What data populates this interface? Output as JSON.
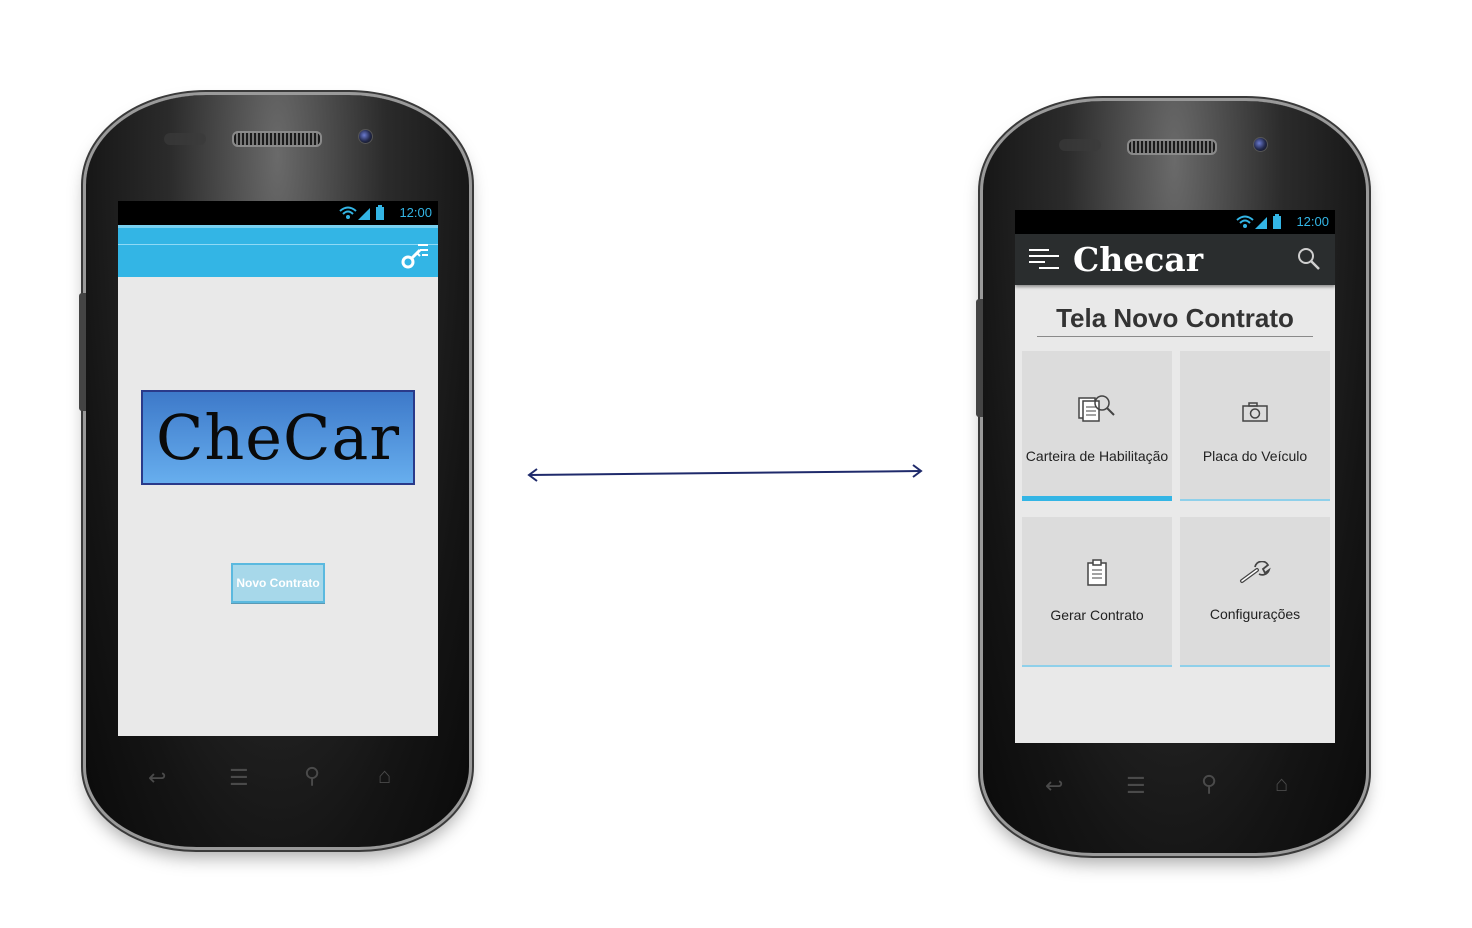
{
  "status_bar": {
    "time": "12:00"
  },
  "left_screen": {
    "logo_text": "CheCar",
    "primary_button": "Novo Contrato",
    "action_icon": "key-menu-icon"
  },
  "right_screen": {
    "app_title": "Checar",
    "nav_icon": "drawer-menu-icon",
    "search_icon": "search-icon",
    "heading": "Tela Novo Contrato",
    "tiles": [
      {
        "label": "Carteira de Habilitação",
        "icon": "document-search-icon",
        "selected": true
      },
      {
        "label": "Placa do Veículo",
        "icon": "camera-icon",
        "selected": false
      },
      {
        "label": "Gerar Contrato",
        "icon": "clipboard-icon",
        "selected": false
      },
      {
        "label": "Configurações",
        "icon": "wrench-icon",
        "selected": false
      }
    ]
  },
  "colors": {
    "accent": "#33b5e5",
    "action_bar_dark": "#2a2d2e",
    "logo_gradient_top": "#3d79c9",
    "arrow": "#1f2a6b"
  }
}
